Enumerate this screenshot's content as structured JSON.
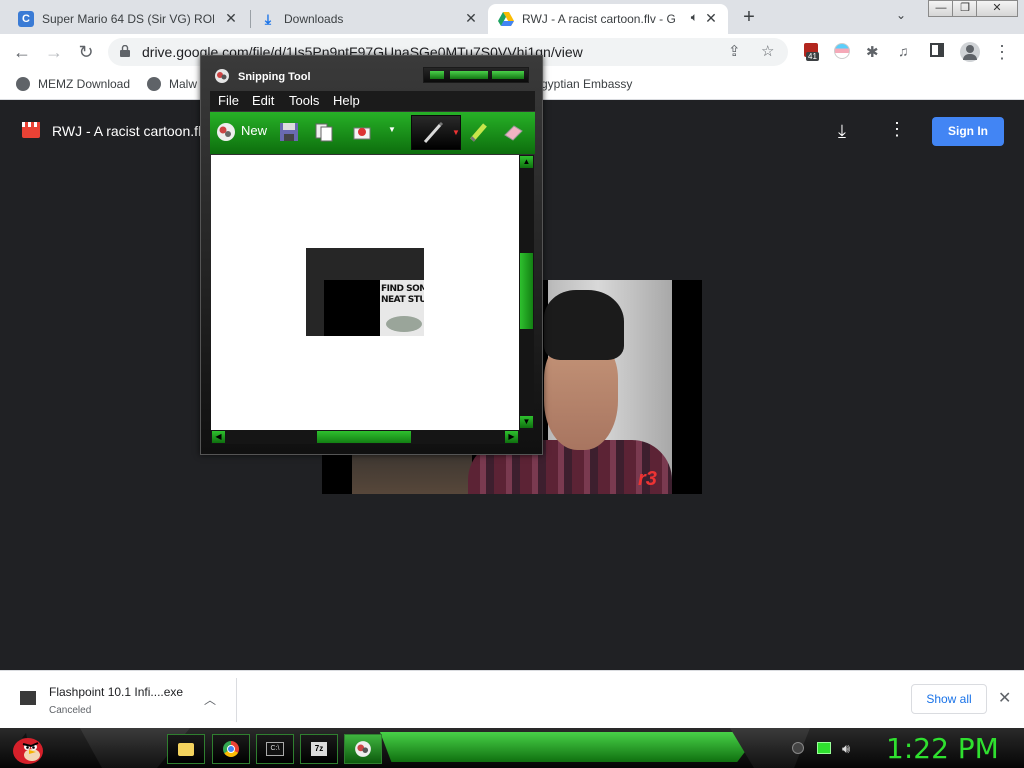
{
  "browser": {
    "tabs": [
      {
        "title": "Super Mario 64 DS (Sir VG) ROM",
        "favicon": "g-favicon"
      },
      {
        "title": "Downloads",
        "favicon": "download-icon"
      },
      {
        "title": "RWJ - A racist cartoon.flv - G",
        "favicon": "google-drive-icon",
        "active": true,
        "audio": true
      }
    ],
    "url": "drive.google.com/file/d/1Is5Pn9ntF97GUnaSGe0MTu7S0VVhi1gn/view",
    "extension_badge": "41",
    "bookmarks": [
      {
        "label": "MEMZ Download"
      },
      {
        "label": "Malw"
      },
      {
        "label": "gyptian Embassy"
      }
    ]
  },
  "viewer": {
    "file_title": "RWJ - A racist cartoon.flv",
    "sign_in_label": "Sign In",
    "video_logo": "r3"
  },
  "snipping_tool": {
    "title": "Snipping Tool",
    "menu": [
      "File",
      "Edit",
      "Tools",
      "Help"
    ],
    "new_label": "New",
    "capture_text": "FIND SOM\nNEAT STU"
  },
  "download_shelf": {
    "file_name": "Flashpoint 10.1 Infi....exe",
    "status": "Canceled",
    "show_all_label": "Show all"
  },
  "taskbar": {
    "clock": "1:22 PM"
  },
  "colors": {
    "chrome_tabstrip": "#dee1e6",
    "drive_bg": "#202124",
    "sign_in_blue": "#4285f4",
    "snip_green": "#27b127",
    "clock_green": "#2fe02f"
  }
}
